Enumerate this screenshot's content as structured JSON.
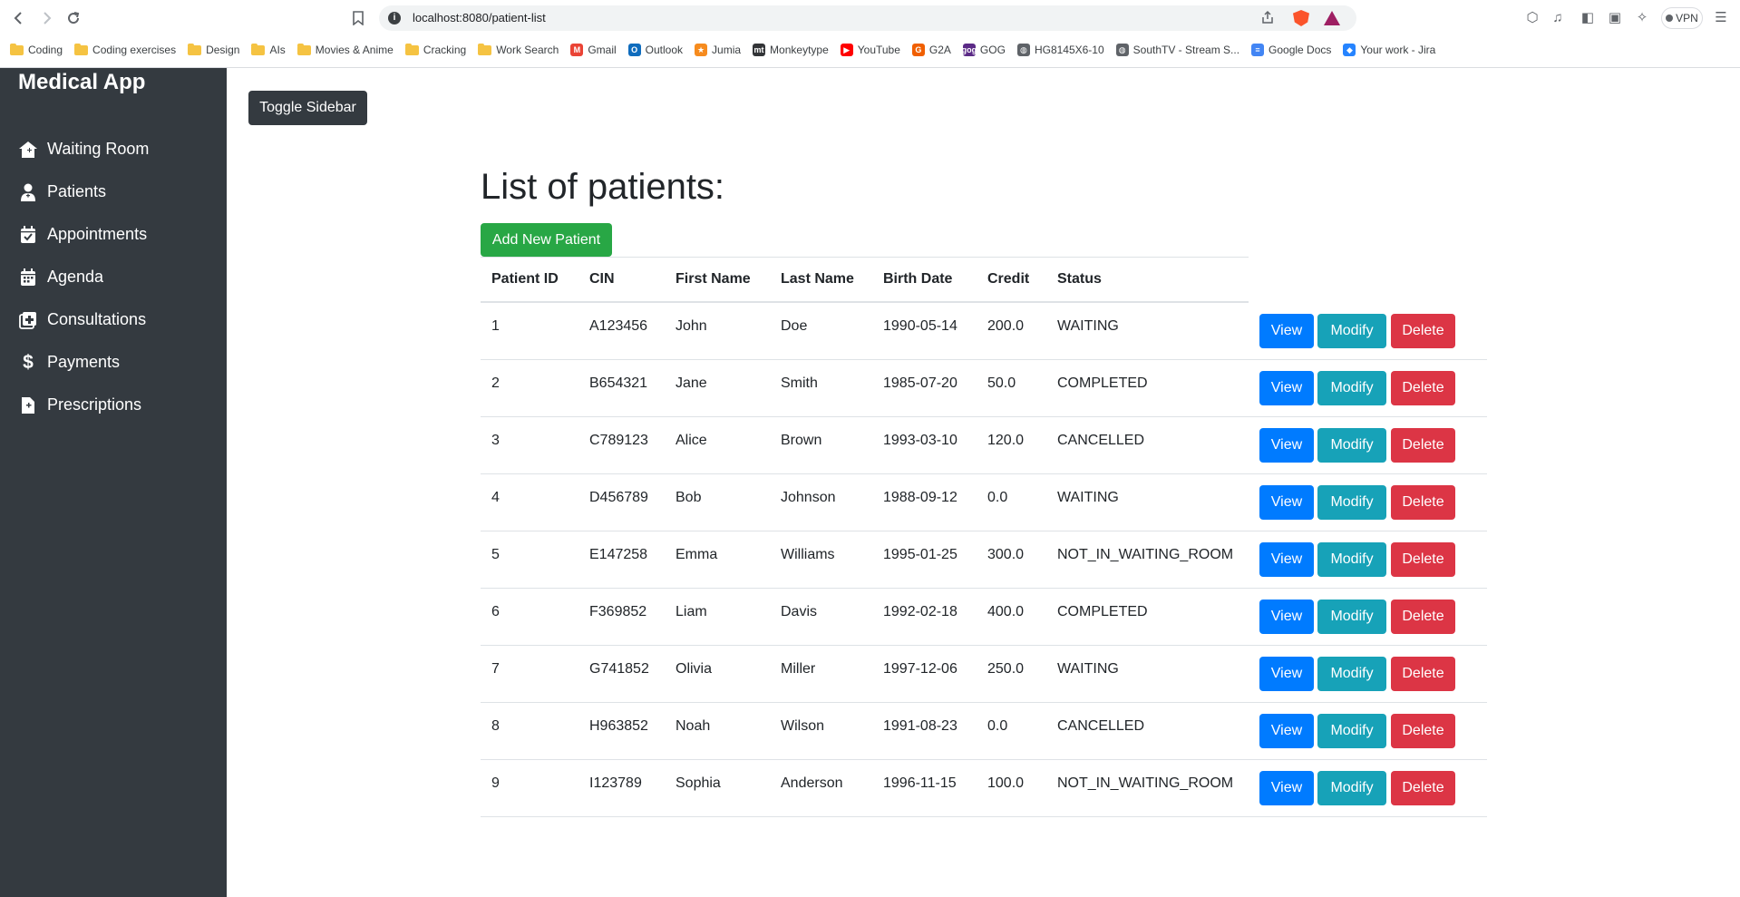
{
  "browser": {
    "url": "localhost:8080/patient-list",
    "vpn_label": "VPN",
    "bookmarks": [
      {
        "label": "Coding",
        "type": "folder"
      },
      {
        "label": "Coding exercises",
        "type": "folder"
      },
      {
        "label": "Design",
        "type": "folder"
      },
      {
        "label": "AIs",
        "type": "folder"
      },
      {
        "label": "Movies & Anime",
        "type": "folder"
      },
      {
        "label": "Cracking",
        "type": "folder"
      },
      {
        "label": "Work Search",
        "type": "folder"
      },
      {
        "label": "Gmail",
        "type": "site",
        "icon": "gmail-icon",
        "color": "#ea4335",
        "glyph": "M"
      },
      {
        "label": "Outlook",
        "type": "site",
        "icon": "outlook-icon",
        "color": "#0f6cbd",
        "glyph": "O"
      },
      {
        "label": "Jumia",
        "type": "site",
        "icon": "jumia-icon",
        "color": "#f68b1e",
        "glyph": "★"
      },
      {
        "label": "Monkeytype",
        "type": "site",
        "icon": "monkeytype-icon",
        "color": "#323437",
        "glyph": "mt"
      },
      {
        "label": "YouTube",
        "type": "site",
        "icon": "youtube-icon",
        "color": "#ff0000",
        "glyph": "▶"
      },
      {
        "label": "G2A",
        "type": "site",
        "icon": "g2a-icon",
        "color": "#f05f00",
        "glyph": "G"
      },
      {
        "label": "GOG",
        "type": "site",
        "icon": "gog-icon",
        "color": "#5b2a86",
        "glyph": "gog"
      },
      {
        "label": "HG8145X6-10",
        "type": "site",
        "icon": "globe-icon",
        "color": "#5f6368",
        "glyph": "◍"
      },
      {
        "label": "SouthTV - Stream S...",
        "type": "site",
        "icon": "globe-icon",
        "color": "#5f6368",
        "glyph": "◍"
      },
      {
        "label": "Google Docs",
        "type": "site",
        "icon": "google-docs-icon",
        "color": "#4285f4",
        "glyph": "≡"
      },
      {
        "label": "Your work - Jira",
        "type": "site",
        "icon": "jira-icon",
        "color": "#2684ff",
        "glyph": "◆"
      }
    ]
  },
  "sidebar": {
    "brand": "Medical App",
    "items": [
      {
        "label": "Waiting Room",
        "icon": "clinic-house-icon"
      },
      {
        "label": "Patients",
        "icon": "patient-icon"
      },
      {
        "label": "Appointments",
        "icon": "calendar-check-icon"
      },
      {
        "label": "Agenda",
        "icon": "calendar-icon"
      },
      {
        "label": "Consultations",
        "icon": "medical-plus-icon"
      },
      {
        "label": "Payments",
        "icon": "dollar-icon"
      },
      {
        "label": "Prescriptions",
        "icon": "prescription-file-icon"
      }
    ]
  },
  "main": {
    "toggle_label": "Toggle Sidebar",
    "title": "List of patients:",
    "add_label": "Add New Patient",
    "columns": [
      "Patient ID",
      "CIN",
      "First Name",
      "Last Name",
      "Birth Date",
      "Credit",
      "Status"
    ],
    "actions": {
      "view": "View",
      "modify": "Modify",
      "delete": "Delete"
    },
    "rows": [
      [
        "1",
        "A123456",
        "John",
        "Doe",
        "1990-05-14",
        "200.0",
        "WAITING"
      ],
      [
        "2",
        "B654321",
        "Jane",
        "Smith",
        "1985-07-20",
        "50.0",
        "COMPLETED"
      ],
      [
        "3",
        "C789123",
        "Alice",
        "Brown",
        "1993-03-10",
        "120.0",
        "CANCELLED"
      ],
      [
        "4",
        "D456789",
        "Bob",
        "Johnson",
        "1988-09-12",
        "0.0",
        "WAITING"
      ],
      [
        "5",
        "E147258",
        "Emma",
        "Williams",
        "1995-01-25",
        "300.0",
        "NOT_IN_WAITING_ROOM"
      ],
      [
        "6",
        "F369852",
        "Liam",
        "Davis",
        "1992-02-18",
        "400.0",
        "COMPLETED"
      ],
      [
        "7",
        "G741852",
        "Olivia",
        "Miller",
        "1997-12-06",
        "250.0",
        "WAITING"
      ],
      [
        "8",
        "H963852",
        "Noah",
        "Wilson",
        "1991-08-23",
        "0.0",
        "CANCELLED"
      ],
      [
        "9",
        "I123789",
        "Sophia",
        "Anderson",
        "1996-11-15",
        "100.0",
        "NOT_IN_WAITING_ROOM"
      ]
    ],
    "colors": {
      "view": "#007bff",
      "modify": "#17a2b8",
      "delete": "#dc3545",
      "add": "#28a745",
      "sidebar": "#343a40"
    }
  }
}
